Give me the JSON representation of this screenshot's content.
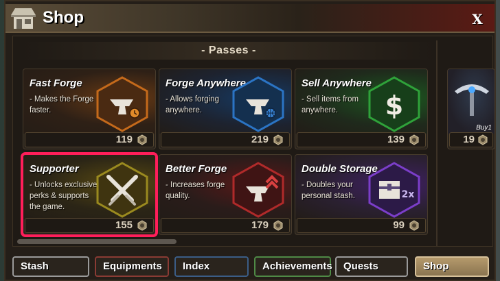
{
  "window": {
    "title": "Shop",
    "close_label": "X"
  },
  "section": {
    "title": "- Passes -"
  },
  "cards": [
    {
      "title": "Fast Forge",
      "desc": "- Makes the Forge faster.",
      "price": "119",
      "color": "#c56a1b",
      "icon": "anvil-clock-icon"
    },
    {
      "title": "Forge Anywhere",
      "desc": "- Allows forging anywhere.",
      "price": "219",
      "color": "#2b74c4",
      "icon": "anvil-globe-icon"
    },
    {
      "title": "Sell Anywhere",
      "desc": "- Sell items from anywhere.",
      "price": "139",
      "color": "#2fa23a",
      "icon": "dollar-icon"
    },
    {
      "title": "Supporter",
      "desc": "- Unlocks exclusive perks & supports the game.",
      "price": "155",
      "color": "#9a8a1f",
      "icon": "crossed-swords-icon"
    },
    {
      "title": "Better Forge",
      "desc": "- Increases forge quality.",
      "price": "179",
      "color": "#b02a2a",
      "icon": "anvil-up-icon"
    },
    {
      "title": "Double Storage",
      "desc": "- Doubles your personal stash.",
      "price": "99",
      "color": "#7b3ec9",
      "icon": "chest-2x-icon"
    }
  ],
  "partial_card": {
    "label": "Buy1",
    "price": "19",
    "icon": "pickaxe-icon"
  },
  "tabs": [
    {
      "label": "Stash",
      "style": "gray"
    },
    {
      "label": "Equipments",
      "style": "red"
    },
    {
      "label": "Index",
      "style": "blue"
    },
    {
      "label": "Achievements",
      "style": "green"
    },
    {
      "label": "Quests",
      "style": "gray"
    },
    {
      "label": "Shop",
      "style": "active"
    }
  ]
}
